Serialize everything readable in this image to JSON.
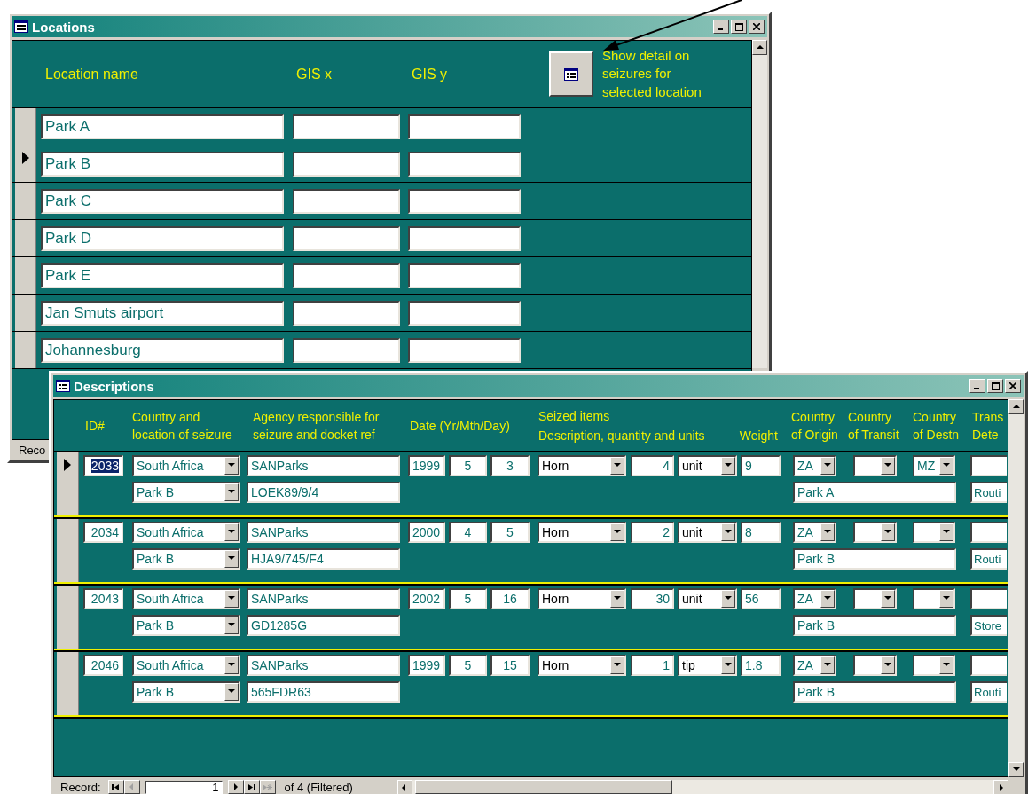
{
  "locations_window": {
    "title": "Locations",
    "headers": {
      "name": "Location name",
      "gis_x": "GIS x",
      "gis_y": "GIS y"
    },
    "detail_button_caption": "Show detail on\nseizures for\nselected location",
    "rows": [
      {
        "name": "Park A",
        "selected": false
      },
      {
        "name": "Park B",
        "selected": true
      },
      {
        "name": "Park C",
        "selected": false
      },
      {
        "name": "Park D",
        "selected": false
      },
      {
        "name": "Park E",
        "selected": false
      },
      {
        "name": "Jan Smuts airport",
        "selected": false
      },
      {
        "name": "Johannesburg",
        "selected": false
      }
    ],
    "status_bar": "Reco"
  },
  "descriptions_window": {
    "title": "Descriptions",
    "headers": {
      "id": "ID#",
      "country_location": "Country and\nlocation of seizure",
      "agency": "Agency responsible for\nseizure and docket ref",
      "date": "Date (Yr/Mth/Day)",
      "seized_items": "Seized items",
      "seized_description": "Description, quantity and units",
      "weight": "Weight",
      "origin": "Country\nof Origin",
      "transit": "Country\nof Transit",
      "destination": "Country\nof Destn",
      "column_14": "Trans\nDete"
    },
    "records": [
      {
        "id": "2033",
        "country": "South Africa",
        "location": "Park B",
        "agency": "SANParks",
        "docket": "LOEK89/9/4",
        "year": "1999",
        "month": "5",
        "day": "3",
        "item": "Horn",
        "quantity": "4",
        "unit": "unit",
        "weight": "9",
        "origin": "ZA",
        "destination": "MZ",
        "origin_location": "Park A",
        "column_14": "Routi",
        "selected": true
      },
      {
        "id": "2034",
        "country": "South Africa",
        "location": "Park B",
        "agency": "SANParks",
        "docket": "HJA9/745/F4",
        "year": "2000",
        "month": "4",
        "day": "5",
        "item": "Horn",
        "quantity": "2",
        "unit": "unit",
        "weight": "8",
        "origin": "ZA",
        "origin_location": "Park B",
        "column_14": "Routi",
        "selected": false
      },
      {
        "id": "2043",
        "country": "South Africa",
        "location": "Park B",
        "agency": "SANParks",
        "docket": "GD1285G",
        "year": "2002",
        "month": "5",
        "day": "16",
        "item": "Horn",
        "quantity": "30",
        "unit": "unit",
        "weight": "56",
        "origin": "ZA",
        "origin_location": "Park B",
        "column_14": "Store",
        "selected": false
      },
      {
        "id": "2046",
        "country": "South Africa",
        "location": "Park B",
        "agency": "SANParks",
        "docket": "565FDR63",
        "year": "1999",
        "month": "5",
        "day": "15",
        "item": "Horn",
        "quantity": "1",
        "unit": "tip",
        "weight": "1.8",
        "origin": "ZA",
        "origin_location": "Park B",
        "column_14": "Routi",
        "selected": false
      }
    ],
    "status_bar": {
      "label": "Record:",
      "current": "1",
      "total": "of 4 (Filtered)"
    }
  }
}
